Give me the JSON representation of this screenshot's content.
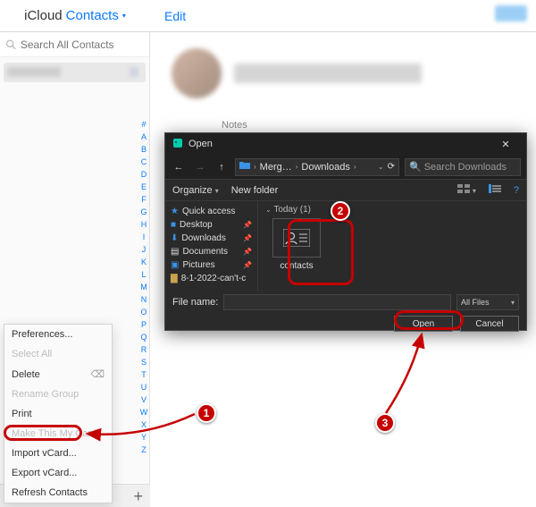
{
  "header": {
    "brand_left": "iCloud",
    "brand_right": "Contacts",
    "edit": "Edit"
  },
  "sidebar": {
    "search_placeholder": "Search All Contacts",
    "az": [
      "#",
      "A",
      "B",
      "C",
      "D",
      "E",
      "F",
      "G",
      "H",
      "I",
      "J",
      "K",
      "L",
      "M",
      "N",
      "O",
      "P",
      "Q",
      "R",
      "S",
      "T",
      "U",
      "V",
      "W",
      "X",
      "Y",
      "Z"
    ]
  },
  "notes": {
    "label": "Notes"
  },
  "dialog": {
    "title": "Open",
    "path": [
      "Merg…",
      "Downloads"
    ],
    "search_placeholder": "Search Downloads",
    "organize": "Organize",
    "new_folder": "New folder",
    "side": {
      "quick": "Quick access",
      "desktop": "Desktop",
      "downloads": "Downloads",
      "documents": "Documents",
      "pictures": "Pictures",
      "item5": "8-1-2022-can't-c"
    },
    "today": "Today (1)",
    "file_name": "contacts",
    "file_label": "File name:",
    "filter": "All Files",
    "open": "Open",
    "cancel": "Cancel"
  },
  "ctx": {
    "prefs": "Preferences...",
    "select_all": "Select All",
    "delete": "Delete",
    "rename": "Rename Group",
    "print": "Print",
    "mycard": "Make This My Card",
    "import": "Import vCard...",
    "export": "Export vCard...",
    "refresh": "Refresh Contacts"
  },
  "callouts": {
    "c1": "1",
    "c2": "2",
    "c3": "3"
  }
}
